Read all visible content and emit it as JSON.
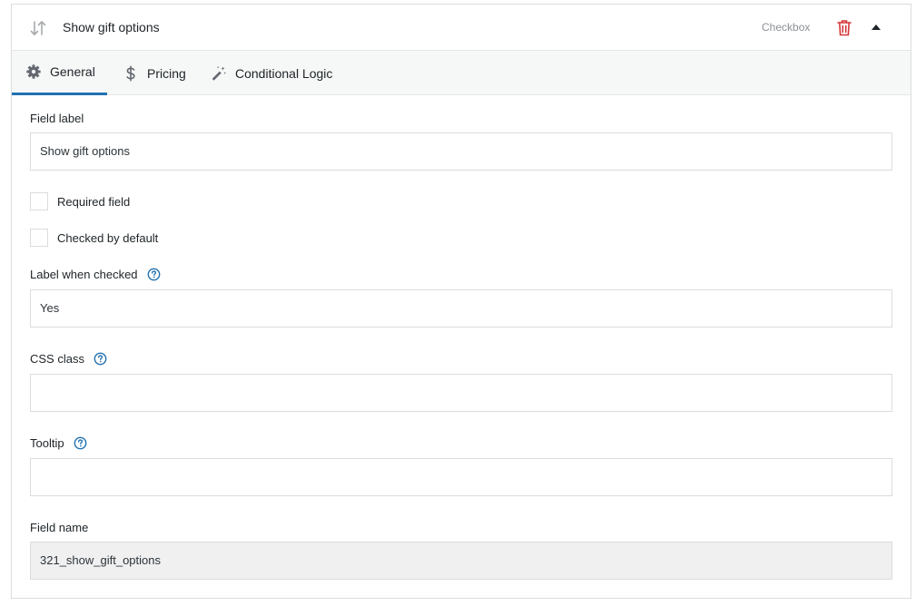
{
  "header": {
    "title": "Show gift options",
    "field_type": "Checkbox"
  },
  "tabs": [
    {
      "label": "General",
      "active": true,
      "icon": "gear-icon"
    },
    {
      "label": "Pricing",
      "active": false,
      "icon": "dollar-icon"
    },
    {
      "label": "Conditional Logic",
      "active": false,
      "icon": "magic-wand-icon"
    }
  ],
  "form": {
    "field_label": {
      "label": "Field label",
      "value": "Show gift options"
    },
    "required": {
      "label": "Required field",
      "checked": false
    },
    "checked_default": {
      "label": "Checked by default",
      "checked": false
    },
    "label_when_checked": {
      "label": "Label when checked",
      "value": "Yes"
    },
    "css_class": {
      "label": "CSS class",
      "value": ""
    },
    "tooltip": {
      "label": "Tooltip",
      "value": ""
    },
    "field_name": {
      "label": "Field name",
      "value": "321_show_gift_options"
    }
  },
  "colors": {
    "accent": "#2271b1",
    "delete": "#d63638"
  }
}
